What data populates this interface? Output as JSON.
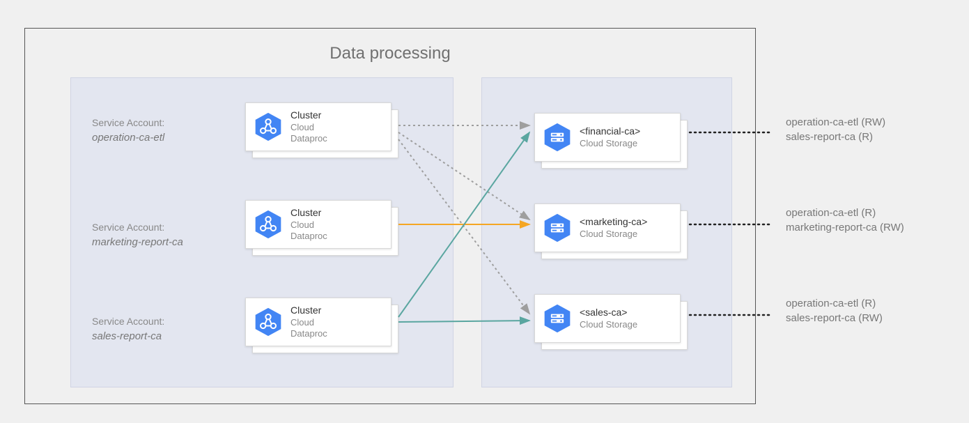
{
  "diagram_title": "Data processing",
  "sa_label": "Service Account:",
  "service_accounts": [
    {
      "name": "operation-ca-etl"
    },
    {
      "name": "marketing-report-ca"
    },
    {
      "name": "sales-report-ca"
    }
  ],
  "cluster_card": {
    "title": "Cluster",
    "sub1": "Cloud",
    "sub2": "Dataproc"
  },
  "storage_cards": [
    {
      "bucket": "<financial-ca>",
      "sub": "Cloud Storage"
    },
    {
      "bucket": "<marketing-ca>",
      "sub": "Cloud Storage"
    },
    {
      "bucket": "<sales-ca>",
      "sub": "Cloud Storage"
    }
  ],
  "permissions": [
    {
      "line1": "operation-ca-etl (RW)",
      "line2": "sales-report-ca (R)"
    },
    {
      "line1": "operation-ca-etl (R)",
      "line2": "marketing-report-ca (RW)"
    },
    {
      "line1": "operation-ca-etl (R)",
      "line2": "sales-report-ca (RW)"
    }
  ],
  "colors": {
    "gcp_blue": "#4285F4",
    "arrow_grey": "#9e9e9e",
    "arrow_teal": "#5aa6a0",
    "arrow_orange": "#f5a623",
    "dot_black": "#222"
  }
}
